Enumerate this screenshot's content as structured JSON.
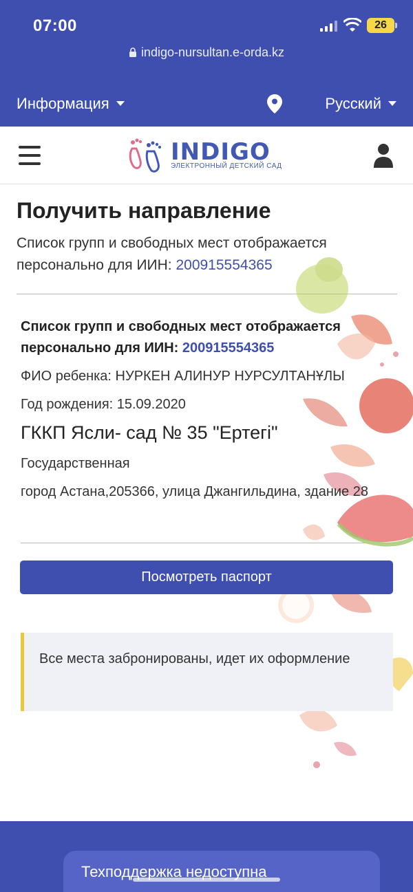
{
  "status_bar": {
    "time": "07:00",
    "battery": "26"
  },
  "browser": {
    "url": "indigo-nursultan.e-orda.kz"
  },
  "topnav": {
    "info_label": "Информация",
    "language_label": "Русский"
  },
  "header": {
    "logo_text": "INDIGO",
    "logo_subtitle": "ЭЛЕКТРОННЫЙ ДЕТСКИЙ САД"
  },
  "page": {
    "title": "Получить направление",
    "intro_text": "Список групп и свободных мест отображается персонально для ИИН: ",
    "iin": "200915554365"
  },
  "card": {
    "heading_text": "Список групп и свободных мест отображается персонально для ИИН: ",
    "iin": "200915554365",
    "child_name": "ФИО ребенка: НУРКЕН АЛИНУР НУРСУЛТАНҰЛЫ",
    "birth_year": "Год рождения: 15.09.2020",
    "school_name": "ГККП Ясли- сад № 35 \"Ертегі\"",
    "ownership": "Государственная",
    "address": "город Астана,205366, улица Джангильдина, здание 28",
    "passport_button": "Посмотреть паспорт"
  },
  "notice": {
    "text": "Все места забронированы, идет их оформление"
  },
  "support": {
    "label": "Техподдержка недоступна"
  },
  "colors": {
    "primary": "#3f4fb0",
    "notice_accent": "#e8c93b",
    "notice_bg": "#f0f1f6"
  }
}
